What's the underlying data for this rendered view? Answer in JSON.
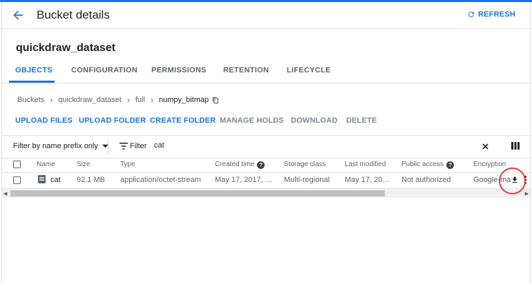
{
  "header": {
    "title": "Bucket details",
    "refresh_label": "REFRESH"
  },
  "bucket": {
    "name": "quickdraw_dataset"
  },
  "tabs": [
    {
      "label": "OBJECTS",
      "active": true
    },
    {
      "label": "CONFIGURATION"
    },
    {
      "label": "PERMISSIONS"
    },
    {
      "label": "RETENTION"
    },
    {
      "label": "LIFECYCLE"
    }
  ],
  "breadcrumb": [
    "Buckets",
    "quickdraw_dataset",
    "full",
    "numpy_bitmap"
  ],
  "actions": [
    {
      "label": "UPLOAD FILES",
      "enabled": true
    },
    {
      "label": "UPLOAD FOLDER",
      "enabled": true
    },
    {
      "label": "CREATE FOLDER",
      "enabled": true
    },
    {
      "label": "MANAGE HOLDS",
      "enabled": false
    },
    {
      "label": "DOWNLOAD",
      "enabled": false
    },
    {
      "label": "DELETE",
      "enabled": false
    }
  ],
  "filter": {
    "prefix_dropdown": "Filter by name prefix only",
    "label": "Filter",
    "value": "cat"
  },
  "table": {
    "columns": [
      "Name",
      "Size",
      "Type",
      "Created time",
      "Storage class",
      "Last modified",
      "Public access",
      "Encryption"
    ],
    "rows": [
      {
        "name": "cat",
        "size": "92.1 MB",
        "type": "application/octet-stream",
        "created": "May 17, 2017, …",
        "storage_class": "Multi-regional",
        "last_modified": "May 17, 20…",
        "public_access": "Not authorized",
        "encryption": "Google-ma"
      }
    ]
  },
  "icons": {
    "back": "arrow-back-icon",
    "refresh": "refresh-icon",
    "copy": "copy-icon",
    "dropdown": "arrow-drop-down-icon",
    "filter": "filter-list-icon",
    "clear": "close-icon",
    "columns": "column-display-icon",
    "help": "help-icon",
    "file": "file-icon",
    "download": "download-icon",
    "more": "more-vert-icon"
  },
  "colors": {
    "accent": "#1a73e8",
    "annotation": "#e53935"
  }
}
